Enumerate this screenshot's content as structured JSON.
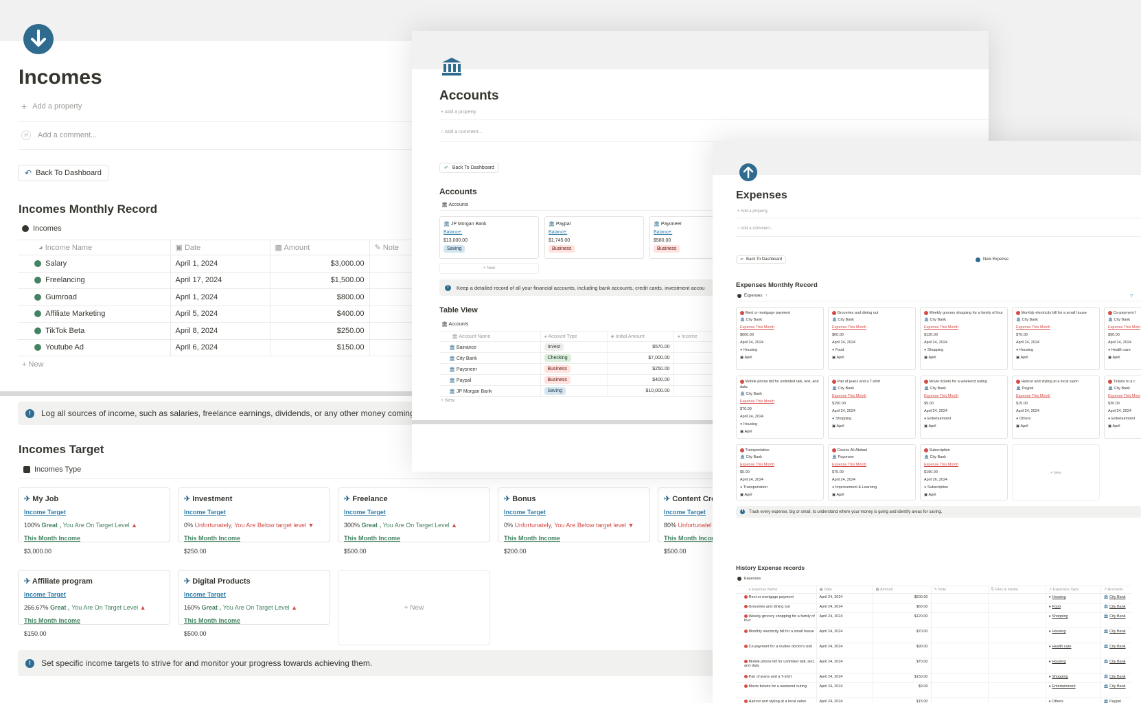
{
  "incomes_page": {
    "title": "Incomes",
    "add_property": "Add a property",
    "comment_avatar": "H",
    "add_comment": "Add a comment...",
    "back_button": "Back To Dashboard",
    "monthly_heading": "Incomes Monthly Record",
    "db_name": "Incomes",
    "columns": [
      "Income Name",
      "Date",
      "Amount",
      "Note"
    ],
    "rows": [
      {
        "name": "Salary",
        "date": "April 1, 2024",
        "amount": "$3,000.00"
      },
      {
        "name": "Freelancing",
        "date": "April 17, 2024",
        "amount": "$1,500.00"
      },
      {
        "name": "Gumroad",
        "date": "April 1, 2024",
        "amount": "$800.00"
      },
      {
        "name": "Affiliate Marketing",
        "date": "April 5, 2024",
        "amount": "$400.00"
      },
      {
        "name": "TikTok Beta",
        "date": "April 8, 2024",
        "amount": "$250.00"
      },
      {
        "name": "Youtube Ad",
        "date": "April 6, 2024",
        "amount": "$150.00"
      }
    ],
    "new_label": "New",
    "callout_text": "Log all sources of income, such as salaries, freelance earnings, dividends, or any other money coming i",
    "target_heading": "Incomes Target",
    "target_db": "Incomes Type",
    "cards_row1": [
      {
        "title": "My Job",
        "link": "Income Target",
        "pct": "100%",
        "msg": "Great , ",
        "msg2": "You Are On Target Level",
        "status": "up",
        "month_label": "This Month Income",
        "value": "$3,000.00"
      },
      {
        "title": "Investment",
        "link": "Income Target",
        "pct": "0%",
        "msg": "Unfortunately, ",
        "msg2": "You Are Below target level",
        "status": "down",
        "month_label": "This Month Income",
        "value": "$250.00"
      },
      {
        "title": "Freelance",
        "link": "Income Target",
        "pct": "300%",
        "msg": "Great , ",
        "msg2": "You Are On Target Level",
        "status": "up",
        "month_label": "This Month Income",
        "value": "$500.00"
      },
      {
        "title": "Bonus",
        "link": "Income Target",
        "pct": "0%",
        "msg": "Unfortunately, ",
        "msg2": "You Are Below target level",
        "status": "down",
        "month_label": "This Month Income",
        "value": "$200.00"
      },
      {
        "title": "Content Cre",
        "link": "Income Target",
        "pct": "80%",
        "msg": "Unfortunatel",
        "msg2": "",
        "status": "none",
        "month_label": "This Month Incom",
        "value": "$500.00"
      }
    ],
    "cards_row2": [
      {
        "title": "Affiliate program",
        "link": "Income Target",
        "pct": "266.67%",
        "msg": "Great , ",
        "msg2": "You Are On Target Level",
        "status": "up",
        "month_label": "This Month Income",
        "value": "$150.00"
      },
      {
        "title": "Digital Products",
        "link": "Income Target",
        "pct": "160%",
        "msg": "Great , ",
        "msg2": "You Are On Target Level",
        "status": "up",
        "month_label": "This Month Income",
        "value": "$500.00"
      }
    ],
    "card_new": "New",
    "target_callout": "Set specific income targets to strive for and monitor your progress towards achieving them."
  },
  "accounts_page": {
    "title": "Accounts",
    "add_property": "Add a property",
    "add_comment": "Add a comment...",
    "back_button": "Back To Dashboard",
    "heading": "Accounts",
    "db_name": "Accounts",
    "cards": [
      {
        "name": "JP Morgan Bank",
        "balance_label": "Balance:",
        "balance": "$13,000.00",
        "type": "Saving"
      },
      {
        "name": "Paypal",
        "balance_label": "Balance:",
        "balance": "$1,745.00",
        "type": "Business"
      },
      {
        "name": "Payoneer",
        "balance_label": "Balance:",
        "balance": "$580.00",
        "type": "Business"
      }
    ],
    "new_label": "New",
    "callout_text": "Keep a detailed record of all your financial accounts, including bank accounts, credit cards, investment accou",
    "table_heading": "Table View",
    "table_db": "Accounts",
    "columns": [
      "Account Name",
      "Account Type",
      "Initial Amount",
      "Income"
    ],
    "rows": [
      {
        "name": "Bainance",
        "type": "Invest",
        "amount": "$570.00"
      },
      {
        "name": "City Bank",
        "type": "Checking",
        "amount": "$7,000.00"
      },
      {
        "name": "Payoneer",
        "type": "Business",
        "amount": "$250.00"
      },
      {
        "name": "Paypal",
        "type": "Business",
        "amount": "$400.00"
      },
      {
        "name": "JP Morgan Bank",
        "type": "Saving",
        "amount": "$10,000.00"
      }
    ],
    "table_new": "New"
  },
  "expenses_page": {
    "title": "Expenses",
    "add_property": "Add a property",
    "add_comment": "Add a comment...",
    "back_button": "Back To Dashboard",
    "new_expense": "New Expense",
    "monthly_heading": "Expenses Monthly Record",
    "db_name": "Expenses",
    "cards": [
      {
        "title": "Rent or mortgage payment",
        "account": "City Bank",
        "flag": "Expense This Month",
        "amount": "$600.00",
        "date": "April 24, 2024",
        "category": "Housing",
        "month": "April"
      },
      {
        "title": "Groceries and dining out",
        "account": "City Bank",
        "flag": "Expense This Month",
        "amount": "$60.00",
        "date": "April 24, 2024",
        "category": "Food",
        "month": "April"
      },
      {
        "title": "Weekly grocery shopping for a family of four",
        "account": "City Bank",
        "flag": "Expense This Month",
        "amount": "$120.00",
        "date": "April 24, 2024",
        "category": "Shopping",
        "month": "April"
      },
      {
        "title": "Monthly electricity bill for a small house",
        "account": "City Bank",
        "flag": "Expense This Month",
        "amount": "$70.00",
        "date": "April 24, 2024",
        "category": "Housing",
        "month": "April"
      },
      {
        "title": "Co-payment f",
        "account": "City Bank",
        "flag": "Expense This Mont",
        "amount": "$90.00",
        "date": "April 24, 2024",
        "category": "Health care",
        "month": "April"
      },
      {
        "title": "Mobile phone bill for unlimited talk, text, and data",
        "account": "City Bank",
        "flag": "Expense This Month",
        "amount": "$70.00",
        "date": "April 24, 2024",
        "category": "Housing",
        "month": "April"
      },
      {
        "title": "Pair of jeans and a T-shirt",
        "account": "City Bank",
        "flag": "Expense This Month",
        "amount": "$150.00",
        "date": "April 24, 2024",
        "category": "Shopping",
        "month": "April"
      },
      {
        "title": "Movie tickets for a weekend outing",
        "account": "City Bank",
        "flag": "Expense This Month",
        "amount": "$9.00",
        "date": "April 24, 2024",
        "category": "Entertainment",
        "month": "April"
      },
      {
        "title": "Haircut and styling at a local salon",
        "account": "Paypal",
        "flag": "Expense This Month",
        "amount": "$15.00",
        "date": "April 24, 2024",
        "category": "Others",
        "month": "April"
      },
      {
        "title": "Tickets to a c",
        "account": "City Bank",
        "flag": "Expense This Mont",
        "amount": "$30.00",
        "date": "April 24, 2024",
        "category": "Entertainment",
        "month": "April"
      },
      {
        "title": "Transportation",
        "account": "City Bank",
        "flag": "Expense This Month",
        "amount": "$0.00",
        "date": "April 24, 2024",
        "category": "Transportation",
        "month": "April"
      },
      {
        "title": "Course Ali Abdaal",
        "account": "Payoneer",
        "flag": "Expense This Month",
        "amount": "$70.00",
        "date": "April 24, 2024",
        "category": "Improvement & Learning",
        "month": "April"
      },
      {
        "title": "Subscription",
        "account": "City Bank",
        "flag": "Expense This Month",
        "amount": "$190.00",
        "date": "April 26, 2024",
        "category": "Subscription",
        "month": "April"
      }
    ],
    "card_new": "New",
    "callout_text": "Track every expense, big or small, to understand where your money is going and identify areas for saving.",
    "history_heading": "History Expense records",
    "history_db": "Expenses",
    "columns": [
      "Expense Name",
      "Date",
      "Amount",
      "Note",
      "Files & media",
      "Expenses Type",
      "Accounts"
    ],
    "rows": [
      {
        "name": "Rent or mortgage payment",
        "date": "April 24, 2024",
        "amount": "$600.00",
        "type": "Housing",
        "account": "City Bank"
      },
      {
        "name": "Groceries and dining out",
        "date": "April 24, 2024",
        "amount": "$60.00",
        "type": "Food",
        "account": "City Bank"
      },
      {
        "name": "Weekly grocery shopping for a family of four",
        "date": "April 24, 2024",
        "amount": "$120.00",
        "type": "Shopping",
        "account": "City Bank"
      },
      {
        "name": "Monthly electricity bill for a small house",
        "date": "April 24, 2024",
        "amount": "$70.00",
        "type": "Housing",
        "account": "City Bank"
      },
      {
        "name": "Co-payment for a routine doctor's visit",
        "date": "April 24, 2024",
        "amount": "$90.00",
        "type": "Health care",
        "account": "City Bank"
      },
      {
        "name": "Mobile phone bill for unlimited talk, text, and data",
        "date": "April 24, 2024",
        "amount": "$70.00",
        "type": "Housing",
        "account": "City Bank"
      },
      {
        "name": "Pair of jeans and a T-shirt",
        "date": "April 24, 2024",
        "amount": "$150.00",
        "type": "Shopping",
        "account": "City Bank"
      },
      {
        "name": "Movie tickets for a weekend outing",
        "date": "April 24, 2024",
        "amount": "$9.00",
        "type": "Entertainment",
        "account": "City Bank"
      },
      {
        "name": "Haircut and styling at a local salon",
        "date": "April 24, 2024",
        "amount": "$15.00",
        "type": "Others",
        "account": "Paypal"
      }
    ]
  },
  "colors": {
    "accent_blue": "#2e6b8f",
    "green": "#448361",
    "red": "#d44c47",
    "link_blue": "#337ea9"
  }
}
